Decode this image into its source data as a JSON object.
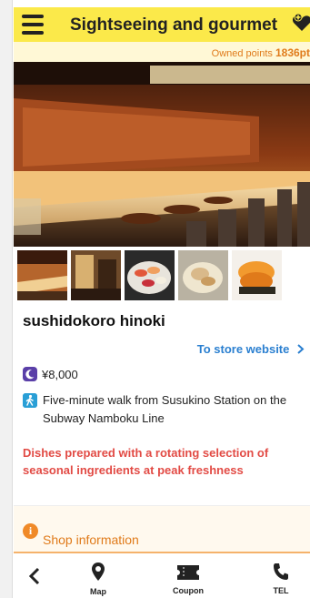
{
  "header": {
    "title": "Sightseeing and gourmet",
    "menu_icon": "hamburger-menu-icon",
    "favorite_icon": "heart-plus-icon"
  },
  "points": {
    "label": "Owned points",
    "value": "1836pt"
  },
  "store": {
    "name": "sushidokoro hinoki",
    "website_link": "To store website",
    "price": "¥8,000",
    "access": "Five-minute walk from Susukino Station on the Subway Namboku Line",
    "description": "Dishes prepared with a rotating selection of seasonal ingredients at peak freshness"
  },
  "shop_info": {
    "label": "Shop information"
  },
  "tabbar": {
    "map": "Map",
    "coupon": "Coupon",
    "tel": "TEL"
  },
  "colors": {
    "header_bg": "#fbe94a",
    "accent_orange": "#e07b1b",
    "link_blue": "#2a7fd0",
    "description_red": "#e24b45"
  }
}
